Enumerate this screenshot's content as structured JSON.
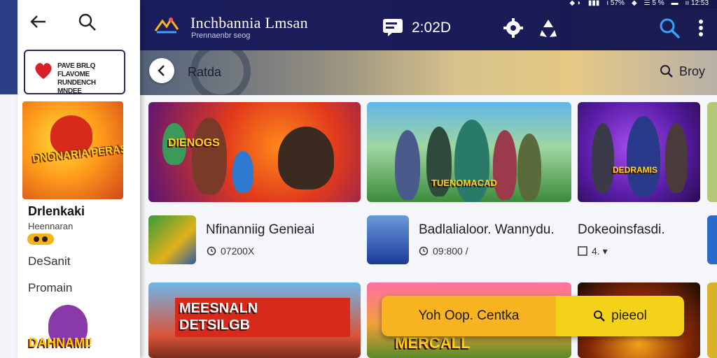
{
  "status_bar": {
    "items": [
      "◆ ◗",
      "▮▮▮",
      "ı 57%",
      "◆",
      "☰ 5 %",
      "▬",
      "ıı 12:53"
    ]
  },
  "header": {
    "title": "Inchbannia Lmsan",
    "subtitle": "Prennaenbr seog",
    "timer": "2:02D"
  },
  "drawer": {
    "promo_text": "PAVE BRLQ FLAVOME RUNDENCH MNDEE",
    "featured_title": "DNONARIA PERASSIG!",
    "game_name": "Drlenkaki",
    "game_sub": "Heennaran",
    "menu_items": [
      "DeSanit",
      "Promain"
    ],
    "bottom_title": "DAHNAMI!"
  },
  "hero": {
    "title": "Ratda",
    "browse_label": "Broy"
  },
  "banners": {
    "b1_title": "DIENOGS",
    "b2_title": "TUENOMACAD",
    "b3_title": "DEDRAMIS",
    "b5_title_line1": "MEESNALN",
    "b5_title_line2": "DETSILGB",
    "b6_title": "MERCALL"
  },
  "games": [
    {
      "name": "Nfinanniig Genieai",
      "meta": "07200X"
    },
    {
      "name": "Badlalialoor. Wannydu.",
      "meta": "09:800 /"
    },
    {
      "name": "Dokeoinsfasdi.",
      "meta": "4. ▾"
    }
  ],
  "cta": {
    "left_label": "Yoh Oop. Centka",
    "right_label": "pieeol"
  },
  "colors": {
    "appbar": "#1c1f5e",
    "accent_search": "#3aa0ff",
    "cta_orange": "#f8b320",
    "cta_yellow": "#f4d21a"
  }
}
